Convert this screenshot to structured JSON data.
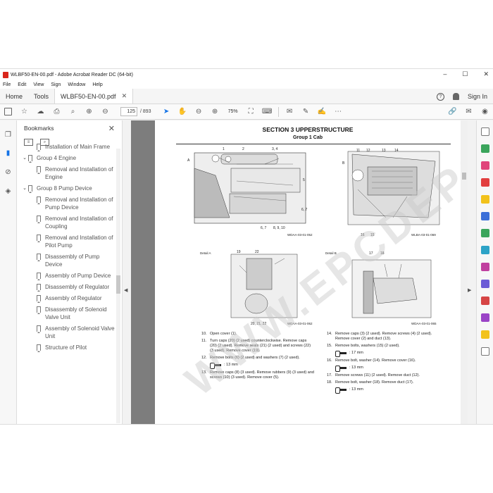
{
  "window": {
    "title": "WLBF50-EN-00.pdf - Adobe Acrobat Reader DC (64-bit)",
    "controls": [
      "–",
      "☐",
      "✕"
    ]
  },
  "menu": [
    "File",
    "Edit",
    "View",
    "Sign",
    "Window",
    "Help"
  ],
  "tabs": {
    "home": "Home",
    "tools": "Tools",
    "doc": "WLBF50-EN-00.pdf",
    "sign_in": "Sign In"
  },
  "toolbar": {
    "page_current": "125",
    "page_total": "/ 893",
    "zoom": "75%"
  },
  "bookmarks": {
    "title": "Bookmarks",
    "items": [
      {
        "label": "Installation of Main Frame",
        "level": 2,
        "expander": ""
      },
      {
        "label": "Group 4 Engine",
        "level": 1,
        "expander": "⌄"
      },
      {
        "label": "Removal and Installation of Engine",
        "level": 2,
        "expander": ""
      },
      {
        "label": "Group 8 Pump Device",
        "level": 1,
        "expander": "⌄"
      },
      {
        "label": "Removal and Installation of Pump Device",
        "level": 2,
        "expander": ""
      },
      {
        "label": "Removal and Installation of Coupling",
        "level": 2,
        "expander": ""
      },
      {
        "label": "Removal and Installation of Pilot Pump",
        "level": 2,
        "expander": ""
      },
      {
        "label": "Disassembly of Pump Device",
        "level": 2,
        "expander": ""
      },
      {
        "label": "Assembly of Pump Device",
        "level": 2,
        "expander": ""
      },
      {
        "label": "Disassembly of Regulator",
        "level": 2,
        "expander": ""
      },
      {
        "label": "Assembly of Regulator",
        "level": 2,
        "expander": ""
      },
      {
        "label": "Disassembly of Solenoid Valve Unit",
        "level": 2,
        "expander": ""
      },
      {
        "label": "Assembly of Solenoid Valve Unit",
        "level": 2,
        "expander": ""
      },
      {
        "label": "Structure of Pilot",
        "level": 2,
        "expander": ""
      }
    ]
  },
  "page": {
    "section_title": "SECTION 3 UPPERSTRUCTURE",
    "group_title": "Group 1 Cab",
    "fig1": {
      "code": "WDAA-03-01-052",
      "labels": [
        "1",
        "2",
        "3, 4",
        "A",
        "5",
        "6, 7",
        "6, 7",
        "8, 9, 10"
      ]
    },
    "fig2": {
      "code": "WLBA-03-01-069",
      "labels": [
        "B",
        "11",
        "12",
        "13",
        "14",
        "16",
        "15"
      ]
    },
    "fig3": {
      "caption": "Detail A",
      "code": "WDAA-03-01-062",
      "labels": [
        "19",
        "22",
        "20, 21, 22"
      ]
    },
    "fig4": {
      "caption": "Detail B",
      "code": "WDAA-03-01-065",
      "labels": [
        "17",
        "18"
      ]
    },
    "steps_left": [
      {
        "n": "10.",
        "text": "Open cover (1)."
      },
      {
        "n": "11.",
        "text": "Turn caps (20) (2 used) counterclockwise. Remove caps (20) (2 used). Remove seals (21) (2 used) and screws (22) (3 used). Remove cover (19)."
      },
      {
        "n": "12.",
        "text": "Remove bolts (6) (2 used) and washers (7) (2 used)."
      },
      {
        "n": "",
        "text": ": 13 mm",
        "tool": true
      },
      {
        "n": "13.",
        "text": "Remove caps (8) (3 used). Remove rubbers (9) (3 used) and screws (10) (3 used). Remove cover (5)."
      }
    ],
    "steps_right": [
      {
        "n": "14.",
        "text": "Remove caps (3) (2 used). Remove screws (4) (2 used). Remove cover (2) and duct (13)."
      },
      {
        "n": "15.",
        "text": "Remove bolts, washers (15) (2 used)."
      },
      {
        "n": "",
        "text": ": 17 mm",
        "tool": true
      },
      {
        "n": "16.",
        "text": "Remove bolt, washer (14). Remove cover (16)."
      },
      {
        "n": "",
        "text": ": 13 mm",
        "tool": true
      },
      {
        "n": "17.",
        "text": "Remove screws (11) (2 used). Remove duct (12)."
      },
      {
        "n": "18.",
        "text": "Remove bolt, washer (18). Remove duct (17)."
      },
      {
        "n": "",
        "text": ": 13 mm",
        "tool": true
      }
    ]
  },
  "watermark": "WWW.EPCDEPOT.COM"
}
